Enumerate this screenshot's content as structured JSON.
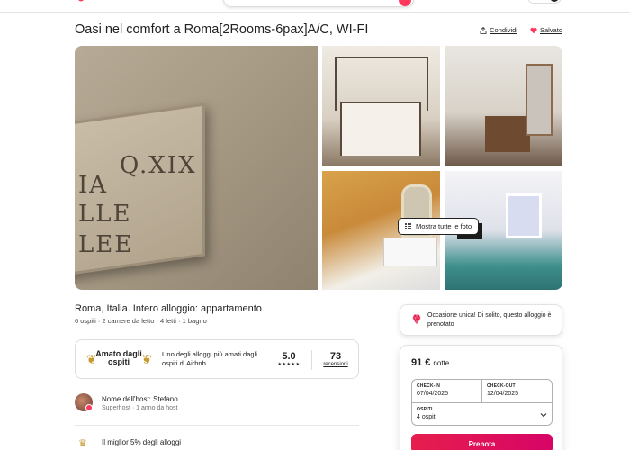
{
  "header": {
    "logo_icon": "airbnb-logo-icon",
    "brand_color": "#ff385c"
  },
  "listing": {
    "title": "Oasi nel comfort a Roma[2Rooms-6pax]A/C, WI-FI",
    "share_label": "Condividi",
    "saved_label": "Salvato",
    "show_all_photos": "Mostra tutte le foto",
    "plaque_text": [
      "Q.XIX",
      "IA",
      "LLE",
      "LEE"
    ]
  },
  "summary": {
    "location": "Roma, Italia. Intero alloggio: appartamento",
    "facts": "6 ospiti · 2 camere da letto · 4 letti · 1 bagno"
  },
  "guest_favorite": {
    "title": "Amato dagli ospiti",
    "description": "Uno degli alloggi più amati dagli ospiti di Airbnb",
    "rating": "5.0",
    "stars": "★★★★★",
    "reviews_count": "73",
    "reviews_label": "recensioni"
  },
  "host": {
    "name": "Nome dell'host: Stefano",
    "subtitle": "Superhost · 1 anno da host"
  },
  "highlight": {
    "text": "Il miglior 5% degli alloggi"
  },
  "rare_find": {
    "text": "Occasione unica! Di solito, questo alloggio è prenotato"
  },
  "booking": {
    "price": "91 €",
    "price_unit": "notte",
    "checkin_label": "CHECK-IN",
    "checkin_value": "07/04/2025",
    "checkout_label": "CHECK-OUT",
    "checkout_value": "12/04/2025",
    "guests_label": "OSPITI",
    "guests_value": "4 ospiti",
    "reserve_label": "Prenota",
    "accent_color": "#e61e4d"
  }
}
